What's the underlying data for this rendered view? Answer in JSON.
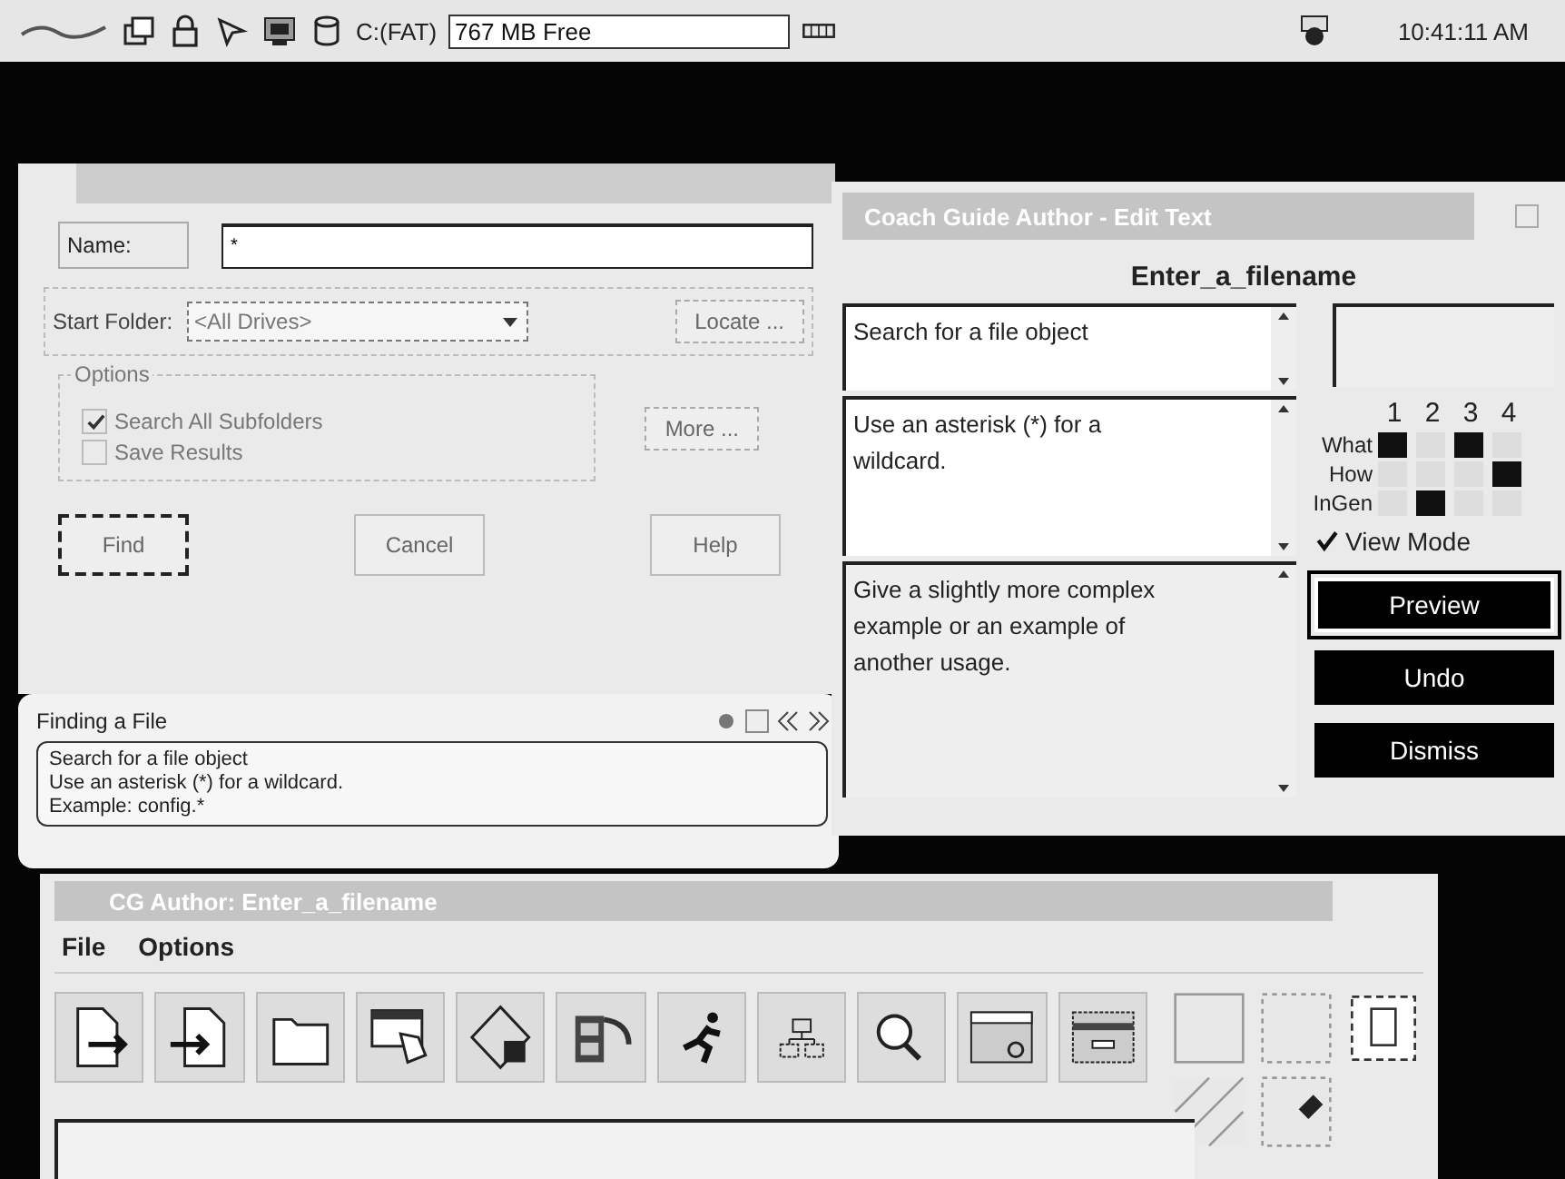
{
  "taskbar": {
    "drive": "C:(FAT)",
    "free": "767 MB Free",
    "clock": "10:41:11 AM"
  },
  "find_dialog": {
    "name_label": "Name:",
    "name_value": "*",
    "folder_label": "Start Folder:",
    "folder_value": "<All Drives>",
    "locate": "Locate ...",
    "options_label": "Options",
    "options": [
      {
        "label": "Search All Subfolders",
        "checked": true
      },
      {
        "label": "Save Results",
        "checked": false
      }
    ],
    "more": "More ...",
    "buttons": [
      {
        "label": "Find",
        "selected": true
      },
      {
        "label": "Cancel",
        "selected": false
      },
      {
        "label": "Help",
        "selected": false
      }
    ]
  },
  "help_panel": {
    "title": "Finding a File",
    "lines": [
      "Search for a file object",
      "Use an asterisk (*) for a wildcard.",
      "Example: config.*"
    ]
  },
  "coach": {
    "title": "Coach Guide Author - Edit Text",
    "heading": "Enter_a_filename",
    "texts": [
      "Search for a file object",
      "Use an asterisk (*) for a wildcard.",
      "Give a slightly more complex example or an example of another usage."
    ],
    "columns": [
      "1",
      "2",
      "3",
      "4"
    ],
    "rows": [
      {
        "label": "What",
        "cells": [
          {
            "on": true
          },
          {
            "on": false
          },
          {
            "on": true
          },
          {
            "on": false
          }
        ]
      },
      {
        "label": "How",
        "cells": [
          {
            "on": false
          },
          {
            "on": false
          },
          {
            "on": false
          },
          {
            "on": true
          }
        ]
      },
      {
        "label": "InGen",
        "cells": [
          {
            "on": false
          },
          {
            "on": true
          },
          {
            "on": false
          },
          {
            "on": false
          }
        ]
      }
    ],
    "view_mode": {
      "label": "View Mode",
      "checked": true
    },
    "buttons": [
      {
        "label": "Preview",
        "selected": true
      },
      {
        "label": "Undo",
        "selected": false
      },
      {
        "label": "Dismiss",
        "selected": false
      }
    ]
  },
  "author": {
    "title": "CG Author: Enter_a_filename",
    "menu": [
      "File",
      "Options"
    ]
  }
}
